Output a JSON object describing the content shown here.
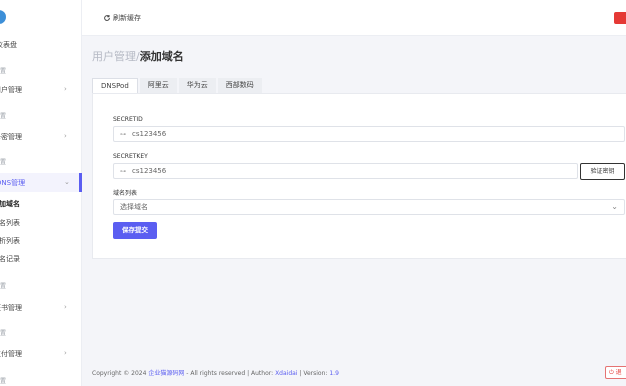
{
  "sidebar": {
    "items": [
      {
        "label": "仪表盘"
      },
      {
        "label": "设置"
      },
      {
        "label": "用户管理"
      },
      {
        "label": "设置"
      },
      {
        "label": "卡密管理"
      },
      {
        "label": "设置"
      },
      {
        "label": "DNS管理"
      },
      {
        "label": "添加域名"
      },
      {
        "label": "域名列表"
      },
      {
        "label": "解析列表"
      },
      {
        "label": "白名记录"
      },
      {
        "label": "设置"
      },
      {
        "label": "证书管理"
      },
      {
        "label": "设置"
      },
      {
        "label": "支付管理"
      },
      {
        "label": "设置"
      }
    ]
  },
  "topbar": {
    "refresh_label": "刷新缓存"
  },
  "page": {
    "breadcrumb_parent": "用户管理/",
    "title": "添加域名"
  },
  "tabs": [
    {
      "label": "DNSPod"
    },
    {
      "label": "阿里云"
    },
    {
      "label": "华为云"
    },
    {
      "label": "西部数码"
    }
  ],
  "form": {
    "secretid_label": "SECRETID",
    "secretid_value": "cs123456",
    "secretkey_label": "SECRETKEY",
    "secretkey_value": "cs123456",
    "verify_label": "验证密钥",
    "domain_label": "域名列表",
    "domain_selected": "选择域名",
    "save_label": "保存提交"
  },
  "footer": {
    "prefix": "Copyright © 2024",
    "site": "企业猫源码网",
    "mid": "- All rights reserved | Author:",
    "author": "Xdaidai",
    "version_label": "| Version:",
    "version": "1.9"
  },
  "logout_label": "退"
}
